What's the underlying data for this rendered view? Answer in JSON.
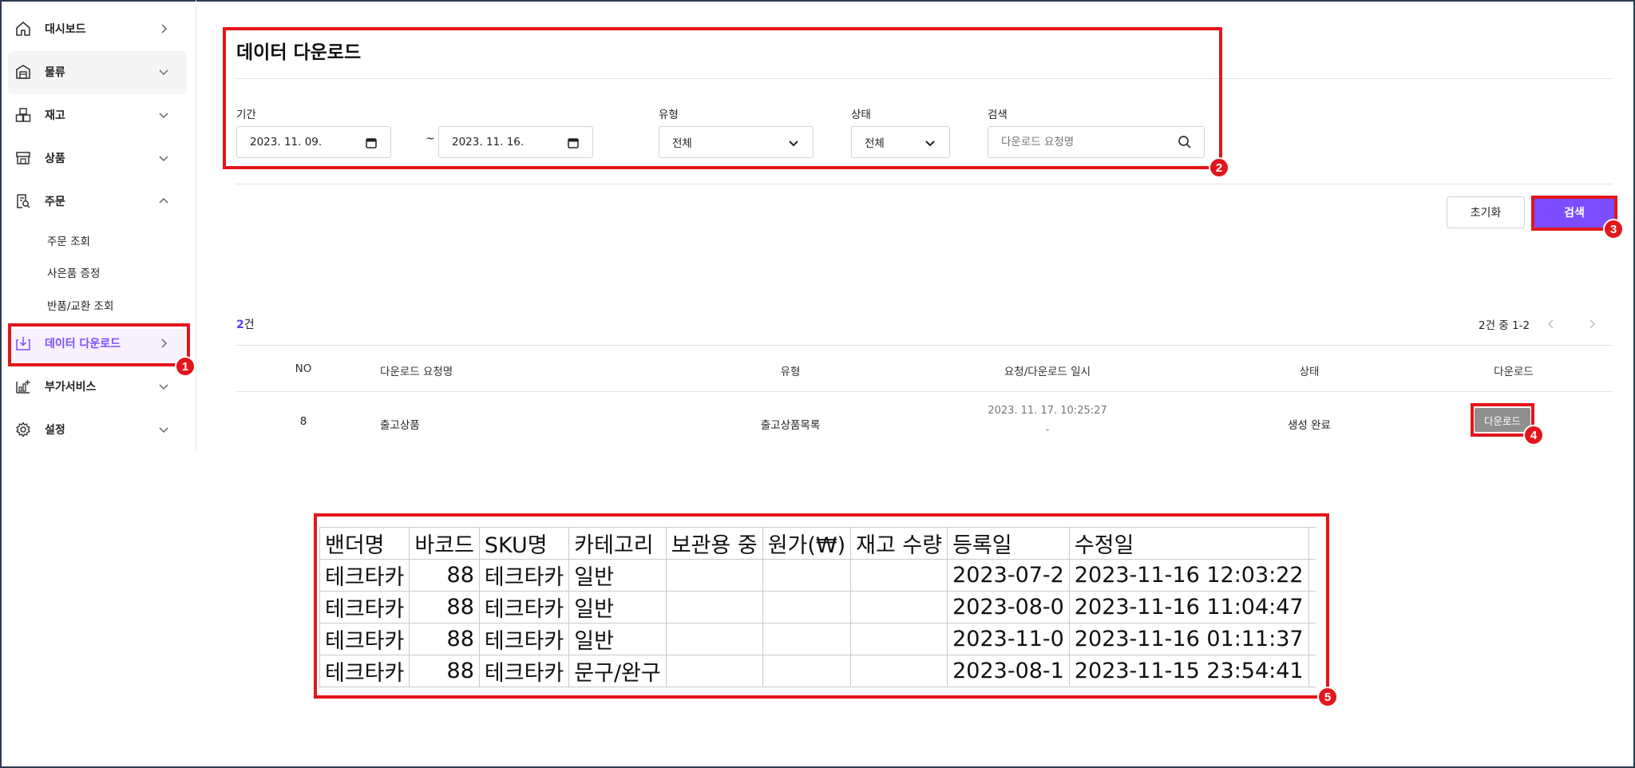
{
  "sidebar": {
    "items": [
      {
        "label": "대시보드",
        "icon": "home-icon",
        "chevron": "chevron-right-icon"
      },
      {
        "label": "물류",
        "icon": "warehouse-icon",
        "chevron": "chevron-down-icon"
      },
      {
        "label": "재고",
        "icon": "boxes-icon",
        "chevron": "chevron-down-icon"
      },
      {
        "label": "상품",
        "icon": "store-icon",
        "chevron": "chevron-down-icon"
      },
      {
        "label": "주문",
        "icon": "order-search-icon",
        "chevron": "chevron-up-icon"
      },
      {
        "label": "데이터 다운로드",
        "icon": "download-tray-icon",
        "chevron": "chevron-right-icon"
      },
      {
        "label": "부가서비스",
        "icon": "services-chart-icon",
        "chevron": "chevron-down-icon"
      },
      {
        "label": "설정",
        "icon": "gear-icon",
        "chevron": "chevron-down-icon"
      }
    ],
    "sub_items": [
      "주문 조회",
      "사은품 증정",
      "반품/교환 조회"
    ],
    "active_color": "#7b4dff"
  },
  "page": {
    "title": "데이터 다운로드"
  },
  "filters": {
    "period_label": "기간",
    "date_from": "2023. 11. 09.",
    "tilde": "~",
    "date_to": "2023. 11. 16.",
    "type_label": "유형",
    "type_value": "전체",
    "status_label": "상태",
    "status_value": "전체",
    "search_label": "검색",
    "search_placeholder": "다운로드 요청명"
  },
  "actions": {
    "reset_label": "초기화",
    "search_label": "검색",
    "search_color": "#7b4dff"
  },
  "results": {
    "count": "2",
    "count_unit": "건",
    "pagination_text": "2건 중 1-2",
    "headers": [
      "NO",
      "다운로드 요청명",
      "유형",
      "요청/다운로드 일시",
      "상태",
      "다운로드"
    ],
    "row": {
      "no": "8",
      "name": "출고상품",
      "type": "출고상품목록",
      "requested_at": "2023. 11. 17. 10:25:27",
      "downloaded_at": "-",
      "status": "생성 완료",
      "download_label": "다운로드"
    }
  },
  "spreadsheet": {
    "headers": [
      "밴더명",
      "바코드",
      "SKU명",
      "카테고리",
      "보관용 중",
      "원가(₩)",
      "재고 수량",
      "등록일",
      "수정일",
      ""
    ],
    "rows": [
      [
        "테크타카",
        "88",
        "테크타카",
        "일반",
        "",
        "",
        "",
        "2023-07-2",
        "2023-11-16  12:03:22",
        ""
      ],
      [
        "테크타카",
        "88",
        "테크타카",
        "일반",
        "",
        "",
        "",
        "2023-08-0",
        "2023-11-16  11:04:47",
        ""
      ],
      [
        "테크타카",
        "88",
        "테크타카",
        "일반",
        "",
        "",
        "",
        "2023-11-0",
        "2023-11-16  01:11:37",
        ""
      ],
      [
        "테크타카",
        "88",
        "테크타카",
        "문구/완구",
        "",
        "",
        "",
        "2023-08-1",
        "2023-11-15  23:54:41",
        ""
      ]
    ]
  },
  "callouts": [
    "1",
    "2",
    "3",
    "4",
    "5"
  ]
}
